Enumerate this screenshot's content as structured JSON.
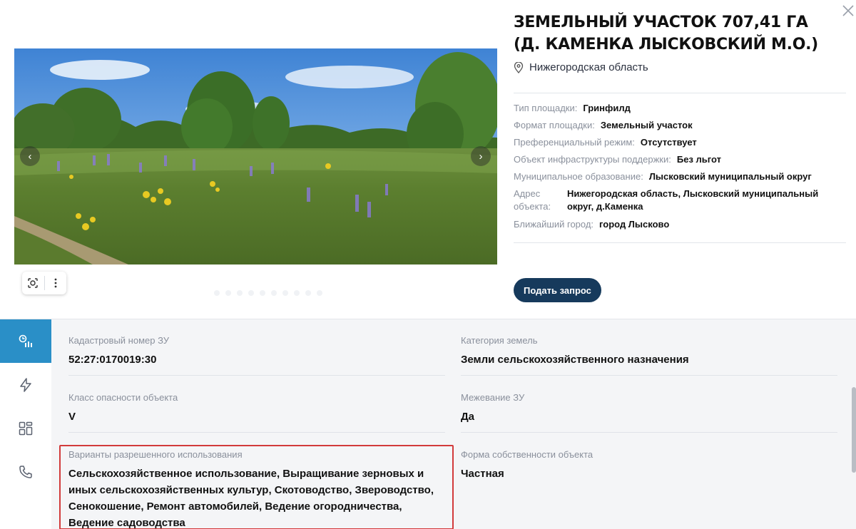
{
  "header": {
    "title": "ЗЕМЕЛЬНЫЙ УЧАСТОК 707,41 ГА (Д. КАМЕНКА ЛЫСКОВСКИЙ М.О.)",
    "location": "Нижегородская область",
    "close_icon": "close-icon"
  },
  "gallery": {
    "prev_icon": "chevron-left-icon",
    "next_icon": "chevron-right-icon",
    "tools": [
      "lens-icon",
      "more-vertical-icon"
    ]
  },
  "properties": [
    {
      "label": "Тип площадки:",
      "value": "Гринфилд"
    },
    {
      "label": "Формат площадки:",
      "value": "Земельный участок"
    },
    {
      "label": "Преференциальный режим:",
      "value": "Отсутствует"
    },
    {
      "label": "Объект инфраструктуры поддержки:",
      "value": "Без льгот"
    },
    {
      "label": "Муниципальное образование:",
      "value": "Лысковский муниципальный округ"
    },
    {
      "label": "Адрес объекта:",
      "value": "Нижегородская область, Лысковский муниципальный округ, д.Каменка"
    },
    {
      "label": "Ближайший город:",
      "value": "город Лысково"
    }
  ],
  "cta": {
    "label": "Подать запрос"
  },
  "sidebar": {
    "items": [
      {
        "icon": "analytics-icon",
        "active": true
      },
      {
        "icon": "lightning-icon",
        "active": false
      },
      {
        "icon": "grid-icon",
        "active": false
      },
      {
        "icon": "phone-icon",
        "active": false
      }
    ]
  },
  "details": [
    {
      "label": "Кадастровый номер ЗУ",
      "value": "52:27:0170019:30"
    },
    {
      "label": "Категория земель",
      "value": "Земли сельскохозяйственного назначения"
    },
    {
      "label": "Класс опасности объекта",
      "value": "V"
    },
    {
      "label": "Межевание ЗУ",
      "value": "Да"
    },
    {
      "label": "Варианты разрешенного использования",
      "value": "Сельскохозяйственное использование, Выращивание зерновых и иных сельскохозяйственных культур, Скотоводство, Звероводство, Сенокошение, Ремонт автомобилей, Ведение огородничества, Ведение садоводства"
    },
    {
      "label": "Форма собственности объекта",
      "value": "Частная"
    }
  ],
  "colors": {
    "accent": "#2a8fc7",
    "button": "#163a5c",
    "highlight": "#d23b3b"
  }
}
